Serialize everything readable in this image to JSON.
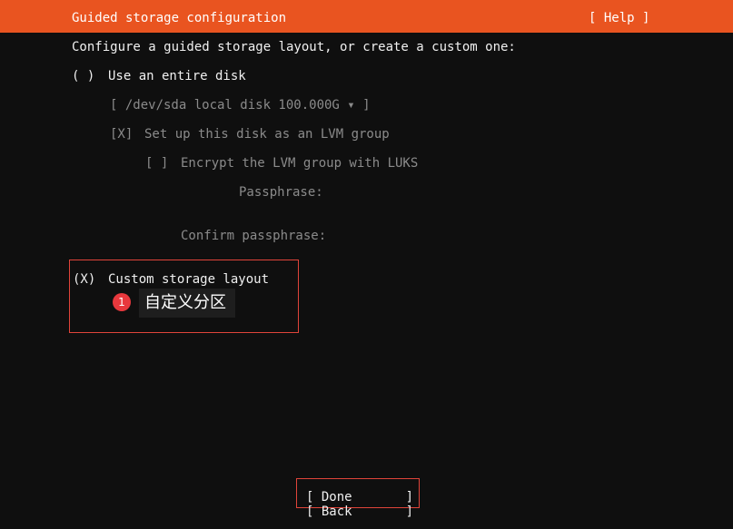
{
  "header": {
    "title": "Guided storage configuration",
    "help_label": "[ Help ]",
    "background_color": "#e95420"
  },
  "intro": "Configure a guided storage layout, or create a custom one:",
  "options": {
    "entire_disk": {
      "radio": "( )",
      "label": "Use an entire disk",
      "disk_select": "[ /dev/sda local disk 100.000G ▾ ]",
      "lvm_checkbox": "[X]",
      "lvm_label": "Set up this disk as an LVM group",
      "luks_checkbox": "[ ]",
      "luks_label": "Encrypt the LVM group with LUKS",
      "passphrase_label": "Passphrase:",
      "confirm_passphrase_label": "Confirm passphrase:"
    },
    "custom_layout": {
      "radio": "(X)",
      "label": "Custom storage layout"
    }
  },
  "annotation": {
    "number": "1",
    "text": "自定义分区",
    "color": "#e8383d"
  },
  "buttons": {
    "done": "[ Done       ]",
    "back": "[ Back       ]"
  }
}
